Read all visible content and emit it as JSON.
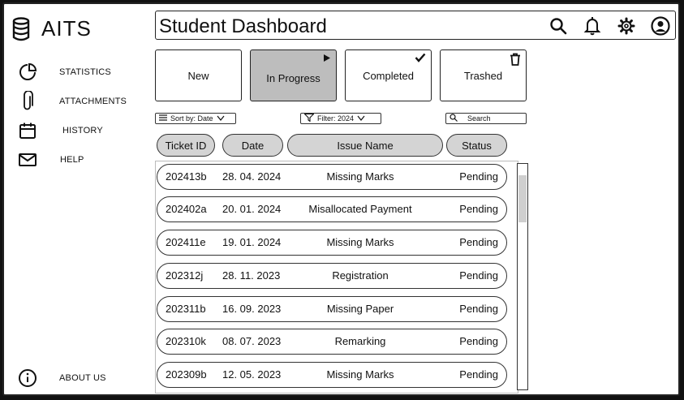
{
  "app": {
    "name": "AITS"
  },
  "sidebar": {
    "items": [
      {
        "label": "STATISTICS",
        "icon": "pie-chart-icon"
      },
      {
        "label": "ATTACHMENTS",
        "icon": "paperclip-icon"
      },
      {
        "label": "HISTORY",
        "icon": "calendar-icon"
      },
      {
        "label": "HELP",
        "icon": "mail-icon"
      }
    ],
    "about": {
      "label": "ABOUT US",
      "icon": "info-icon"
    }
  },
  "header": {
    "title": "Student Dashboard",
    "icons": [
      "search-icon",
      "bell-icon",
      "gear-icon",
      "user-icon"
    ]
  },
  "tabs": [
    {
      "label": "New",
      "badge": ""
    },
    {
      "label": "In Progress",
      "badge": "play-icon",
      "active": true
    },
    {
      "label": "Completed",
      "badge": "check-icon"
    },
    {
      "label": "Trashed",
      "badge": "trash-icon"
    }
  ],
  "controls": {
    "sort_label": "Sort by:  Date",
    "filter_label": "Filter:  2024",
    "search_placeholder": "Search"
  },
  "table": {
    "columns": [
      "Ticket ID",
      "Date",
      "Issue Name",
      "Status"
    ],
    "rows": [
      {
        "id": "202413b",
        "date": "28. 04. 2024",
        "issue": "Missing Marks",
        "status": "Pending"
      },
      {
        "id": "202402a",
        "date": "20. 01. 2024",
        "issue": "Misallocated Payment",
        "status": "Pending"
      },
      {
        "id": "202411e",
        "date": "19. 01. 2024",
        "issue": "Missing Marks",
        "status": "Pending"
      },
      {
        "id": "202312j",
        "date": "28. 11. 2023",
        "issue": "Registration",
        "status": "Pending"
      },
      {
        "id": "202311b",
        "date": "16. 09. 2023",
        "issue": "Missing Paper",
        "status": "Pending"
      },
      {
        "id": "202310k",
        "date": "08. 07. 2023",
        "issue": "Remarking",
        "status": "Pending"
      },
      {
        "id": "202309b",
        "date": "12. 05. 2023",
        "issue": "Missing Marks",
        "status": "Pending"
      }
    ]
  }
}
